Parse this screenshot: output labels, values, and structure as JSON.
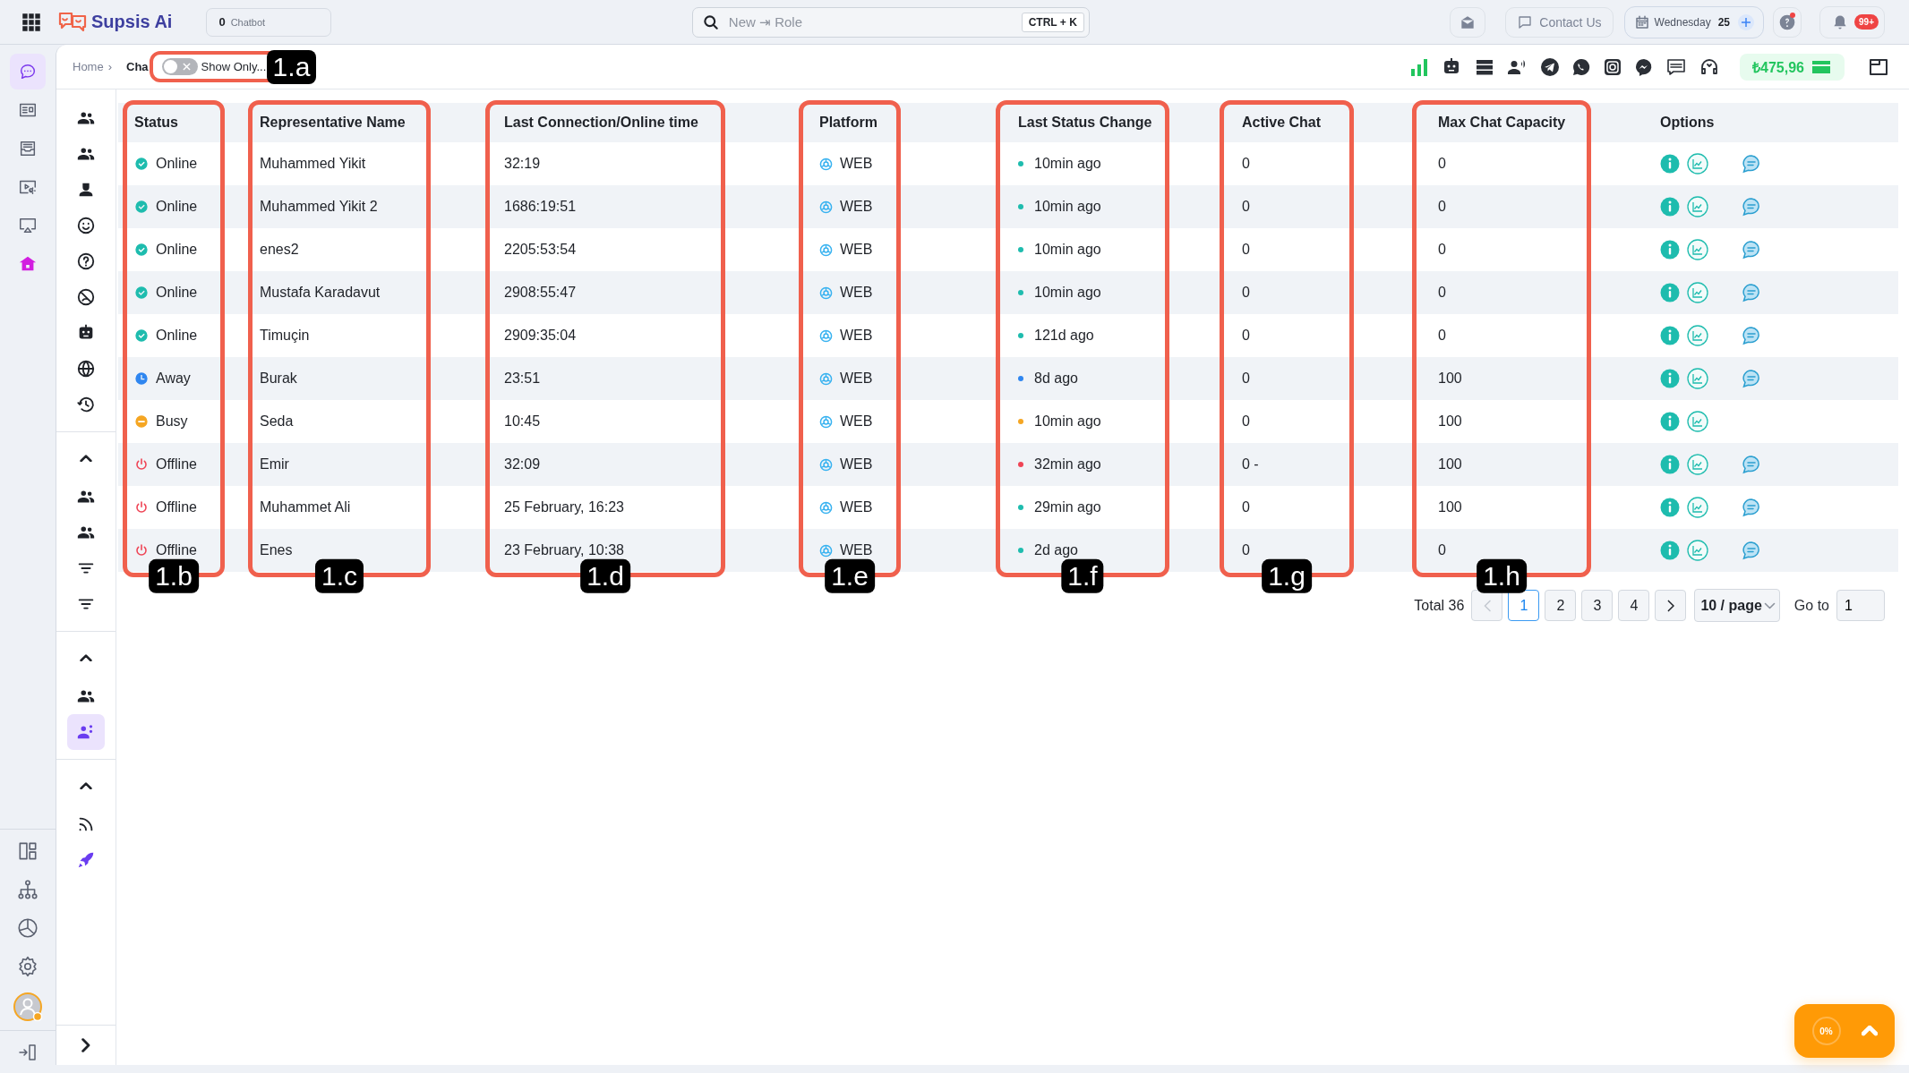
{
  "topbar": {
    "brand": "Supsis Ai",
    "chatbot_count": "0",
    "chatbot_label": "Chatbot",
    "search": {
      "placeholder": "New ⇥ Role",
      "shortcut": "CTRL + K"
    },
    "contact": "Contact Us",
    "date_day": "Wednesday",
    "date_num": "25",
    "notifications": "99+"
  },
  "rail_top": [
    {
      "selected": true
    },
    {
      "selected": false
    },
    {
      "selected": false
    },
    {
      "selected": false
    },
    {
      "selected": false
    },
    {
      "selected": false
    }
  ],
  "rail_bottom": [
    {
      "selected": false
    },
    {
      "selected": false
    },
    {
      "selected": false
    },
    {
      "selected": false
    }
  ],
  "nav_sections": [
    {
      "items": [
        {
          "selected": false
        },
        {
          "selected": false
        },
        {
          "selected": false
        },
        {
          "selected": false
        },
        {
          "selected": false
        },
        {
          "selected": false
        },
        {
          "selected": false
        },
        {
          "selected": false
        },
        {
          "selected": false
        }
      ]
    },
    {
      "expanded": true,
      "items": [
        {
          "selected": false
        },
        {
          "selected": false
        },
        {
          "selected": false
        },
        {
          "selected": false
        }
      ]
    },
    {
      "expanded": true,
      "items": [
        {
          "selected": false
        },
        {
          "selected": true
        }
      ]
    },
    {
      "expanded": true,
      "items": [
        {
          "selected": false
        },
        {
          "selected": false
        }
      ]
    }
  ],
  "breadcrumb": {
    "home": "Home",
    "separator": "›",
    "current": "Cha",
    "toggle": {
      "label": "Show Only...",
      "on": false,
      "callout": "1.a"
    },
    "balance": "₺475,96"
  },
  "table": {
    "columns": [
      {
        "kind": "status",
        "label": "Status",
        "callout": "1.b"
      },
      {
        "kind": "name",
        "label": "Representative Name",
        "callout": "1.c"
      },
      {
        "kind": "last_connection",
        "label": "Last Connection/Online time",
        "callout": "1.d"
      },
      {
        "kind": "platform",
        "label": "Platform",
        "callout": "1.e"
      },
      {
        "kind": "status_change",
        "label": "Last Status Change",
        "callout": "1.f"
      },
      {
        "kind": "active_chat",
        "label": "Active Chat",
        "callout": "1.g"
      },
      {
        "kind": "max_capacity",
        "label": "Max Chat Capacity",
        "callout": "1.h"
      },
      {
        "kind": "options",
        "label": "Options"
      }
    ],
    "rows": [
      {
        "status": {
          "kind": "online",
          "label": "Online"
        },
        "name": "Muhammed Yikit",
        "last_connection": "32:19",
        "platform": "WEB",
        "status_change": {
          "text": "10min ago",
          "color": "#1ebcae"
        },
        "active_chat": "0",
        "max_capacity": "0",
        "chat_option": true
      },
      {
        "status": {
          "kind": "online",
          "label": "Online"
        },
        "name": "Muhammed Yikit 2",
        "last_connection": "1686:19:51",
        "platform": "WEB",
        "status_change": {
          "text": "10min ago",
          "color": "#1ebcae"
        },
        "active_chat": "0",
        "max_capacity": "0",
        "chat_option": true
      },
      {
        "status": {
          "kind": "online",
          "label": "Online"
        },
        "name": "enes2",
        "last_connection": "2205:53:54",
        "platform": "WEB",
        "status_change": {
          "text": "10min ago",
          "color": "#1ebcae"
        },
        "active_chat": "0",
        "max_capacity": "0",
        "chat_option": true
      },
      {
        "status": {
          "kind": "online",
          "label": "Online"
        },
        "name": "Mustafa Karadavut",
        "last_connection": "2908:55:47",
        "platform": "WEB",
        "status_change": {
          "text": "10min ago",
          "color": "#1ebcae"
        },
        "active_chat": "0",
        "max_capacity": "0",
        "chat_option": true
      },
      {
        "status": {
          "kind": "online",
          "label": "Online"
        },
        "name": "Timuçin",
        "last_connection": "2909:35:04",
        "platform": "WEB",
        "status_change": {
          "text": "121d ago",
          "color": "#1ebcae"
        },
        "active_chat": "0",
        "max_capacity": "0",
        "chat_option": true
      },
      {
        "status": {
          "kind": "away",
          "label": "Away"
        },
        "name": "Burak",
        "last_connection": "23:51",
        "platform": "WEB",
        "status_change": {
          "text": "8d ago",
          "color": "#2f86f0"
        },
        "active_chat": "0",
        "max_capacity": "100",
        "chat_option": true
      },
      {
        "status": {
          "kind": "busy",
          "label": "Busy"
        },
        "name": "Seda",
        "last_connection": "10:45",
        "platform": "WEB",
        "status_change": {
          "text": "10min ago",
          "color": "#f5a623"
        },
        "active_chat": "0",
        "max_capacity": "100",
        "chat_option": false
      },
      {
        "status": {
          "kind": "offline",
          "label": "Offline"
        },
        "name": "Emir",
        "last_connection": "32:09",
        "platform": "WEB",
        "status_change": {
          "text": "32min ago",
          "color": "#ef4455"
        },
        "active_chat": "0 -",
        "max_capacity": "100",
        "chat_option": true
      },
      {
        "status": {
          "kind": "offline",
          "label": "Offline"
        },
        "name": "Muhammet Ali",
        "last_connection": "25 February, 16:23",
        "platform": "WEB",
        "status_change": {
          "text": "29min ago",
          "color": "#1ebcae"
        },
        "active_chat": "0",
        "max_capacity": "100",
        "chat_option": true
      },
      {
        "status": {
          "kind": "offline",
          "label": "Offline"
        },
        "name": "Enes",
        "last_connection": "23 February, 10:38",
        "platform": "WEB",
        "status_change": {
          "text": "2d ago",
          "color": "#1ebcae"
        },
        "active_chat": "0",
        "max_capacity": "0",
        "chat_option": true
      }
    ]
  },
  "pagination": {
    "total": "Total 36",
    "pages": [
      {
        "label": "1",
        "selected": true
      },
      {
        "label": "2",
        "selected": false
      },
      {
        "label": "3",
        "selected": false
      },
      {
        "label": "4",
        "selected": false
      }
    ],
    "page_size": "10 / page",
    "goto_label": "Go to",
    "goto_value": "1"
  },
  "widget": {
    "progress": "0%"
  }
}
